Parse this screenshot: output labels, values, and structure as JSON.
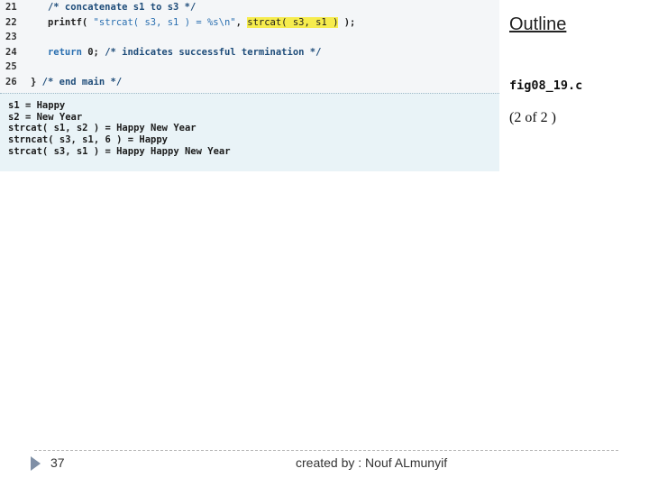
{
  "code": {
    "lines": [
      {
        "num": "21",
        "indent": "   ",
        "parts": [
          {
            "cls": "cm",
            "text": "/* concatenate s1 to s3 */"
          }
        ]
      },
      {
        "num": "22",
        "indent": "   ",
        "parts": [
          {
            "cls": "fn",
            "text": "printf( "
          },
          {
            "cls": "str",
            "text": "\"strcat( s3, s1 ) = %s\\n\""
          },
          {
            "cls": "fn",
            "text": ", "
          },
          {
            "cls": "hl",
            "text": "strcat( s3, s1 )"
          },
          {
            "cls": "fn",
            "text": " );"
          }
        ]
      },
      {
        "num": "23",
        "indent": "",
        "parts": []
      },
      {
        "num": "24",
        "indent": "   ",
        "parts": [
          {
            "cls": "kw",
            "text": "return"
          },
          {
            "cls": "fn",
            "text": " 0; "
          },
          {
            "cls": "cm",
            "text": "/* indicates successful termination */"
          }
        ]
      },
      {
        "num": "25",
        "indent": "",
        "parts": []
      },
      {
        "num": "26",
        "indent": "",
        "parts": [
          {
            "cls": "fn",
            "text": "} "
          },
          {
            "cls": "cm",
            "text": "/* end main */"
          }
        ]
      }
    ]
  },
  "output": {
    "lines": [
      "s1 = Happy",
      "s2 = New Year",
      "strcat( s1, s2 ) = Happy New Year",
      "strncat( s3, s1, 6 ) = Happy",
      "strcat( s3, s1 ) = Happy Happy New Year"
    ]
  },
  "side": {
    "outline": "Outline",
    "file_name": "fig08_19.c",
    "page_info": "(2 of 2 )"
  },
  "footer": {
    "slide_number": "37",
    "credit": "created by : Nouf ALmunyif"
  }
}
